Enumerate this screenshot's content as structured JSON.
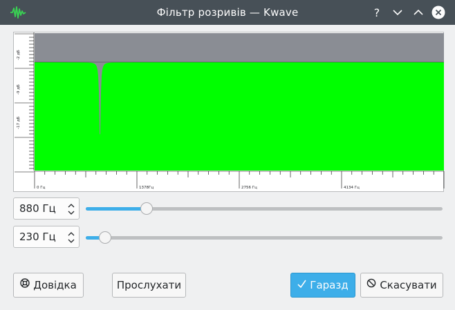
{
  "window": {
    "title": "Фільтр розривів — Kwave",
    "app_icon": "kwave-waveform-icon",
    "controls": [
      "help-icon",
      "minimize-icon",
      "maximize-icon",
      "close-icon"
    ]
  },
  "plot": {
    "background_color": "#8a8d94",
    "fill_color": "#00ff00",
    "y_labels": [
      "-2 дБ",
      "-9 дБ",
      "-17 дБ"
    ],
    "x_labels": [
      "0 Гц",
      "1378Гц",
      "2756 Гц",
      "4134 Гц"
    ],
    "x_max_hz": 5512,
    "notch_center_hz": 880,
    "notch_bandwidth_hz": 230
  },
  "controls": {
    "frequency": {
      "value": "880 Гц",
      "slider_fraction": 0.17
    },
    "bandwidth": {
      "value": "230 Гц",
      "slider_fraction": 0.055
    }
  },
  "buttons": {
    "help": "Довідка",
    "listen": "Прослухати",
    "ok": "Гаразд",
    "cancel": "Скасувати"
  },
  "colors": {
    "titlebar": "#475057",
    "accent": "#3daee9"
  }
}
